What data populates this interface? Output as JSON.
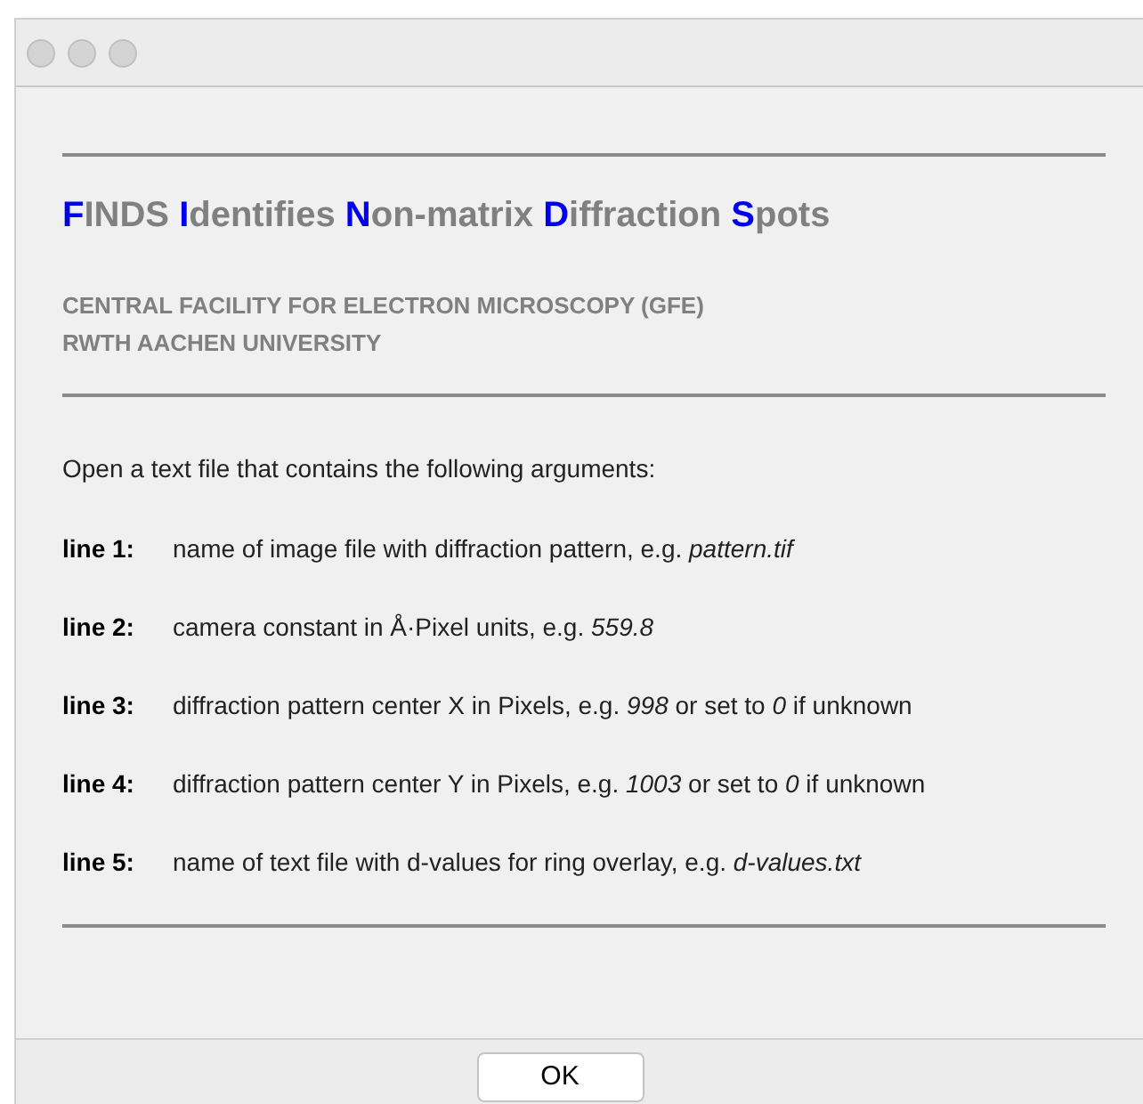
{
  "title_segments": [
    {
      "text": "F",
      "highlight": true
    },
    {
      "text": "INDS ",
      "highlight": false
    },
    {
      "text": "I",
      "highlight": true
    },
    {
      "text": "dentifies ",
      "highlight": false
    },
    {
      "text": "N",
      "highlight": true
    },
    {
      "text": "on-matrix ",
      "highlight": false
    },
    {
      "text": "D",
      "highlight": true
    },
    {
      "text": "iffraction ",
      "highlight": false
    },
    {
      "text": "S",
      "highlight": true
    },
    {
      "text": "pots",
      "highlight": false
    }
  ],
  "affiliation": [
    "CENTRAL FACILITY FOR ELECTRON MICROSCOPY (GFE)",
    "RWTH AACHEN UNIVERSITY"
  ],
  "intro": "Open a text file that contains the following arguments:",
  "arguments": [
    {
      "label": "line 1:",
      "description": "name of image file with diffraction pattern, e.g. *pattern.tif*"
    },
    {
      "label": "line 2:",
      "description": "camera constant in Å·Pixel units, e.g. *559.8*"
    },
    {
      "label": "line 3:",
      "description": "diffraction pattern center X in Pixels, e.g. *998* or set to *0* if unknown"
    },
    {
      "label": "line 4:",
      "description": "diffraction pattern center Y in Pixels, e.g. *1003* or set to *0* if unknown"
    },
    {
      "label": "line 5:",
      "description": "name of text file with d-values for ring overlay, e.g. *d-values.txt*"
    }
  ],
  "buttons": [
    "OK"
  ]
}
